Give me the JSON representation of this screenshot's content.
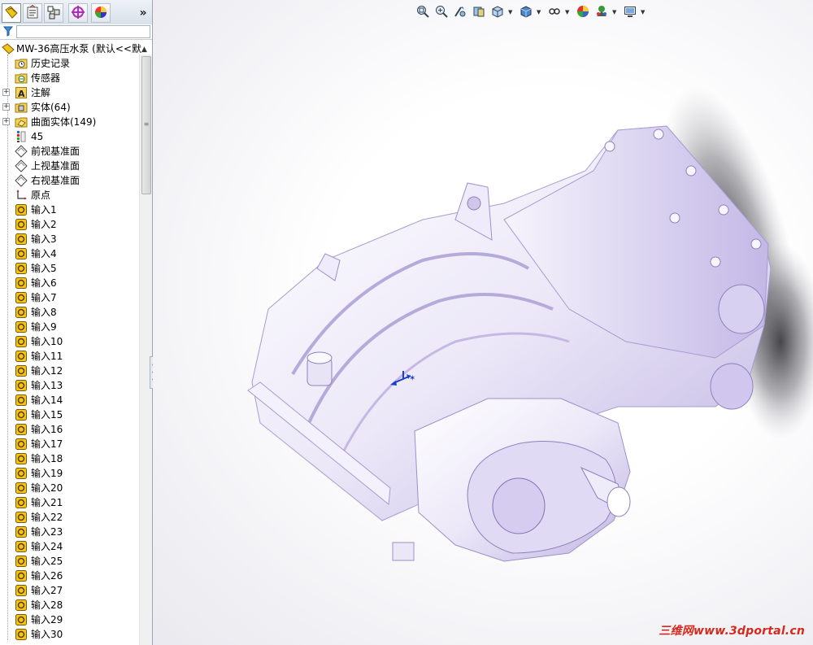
{
  "panel_tabs": [
    {
      "name": "feature-manager",
      "icon": "feature-tree-icon",
      "active": true
    },
    {
      "name": "property-manager",
      "icon": "property-manager-icon",
      "active": false
    },
    {
      "name": "configuration-manager",
      "icon": "configuration-manager-icon",
      "active": false
    },
    {
      "name": "dimxpert-manager",
      "icon": "dimxpert-icon",
      "active": false
    },
    {
      "name": "display-manager",
      "icon": "display-manager-icon",
      "active": false
    }
  ],
  "more_tabs": "»",
  "filter": {
    "icon": "filter-icon",
    "value": ""
  },
  "tree": {
    "root": {
      "label": "MW-36高压水泵 (默认<<默",
      "icon": "part-icon"
    },
    "items": [
      {
        "label": "历史记录",
        "icon": "history-folder-icon",
        "expandable": false
      },
      {
        "label": "传感器",
        "icon": "sensor-folder-icon",
        "expandable": false
      },
      {
        "label": "注解",
        "icon": "annotation-folder-icon",
        "expandable": true
      },
      {
        "label": "实体(64)",
        "icon": "solid-bodies-folder-icon",
        "expandable": true
      },
      {
        "label": "曲面实体(149)",
        "icon": "surface-bodies-folder-icon",
        "expandable": true
      },
      {
        "label": "45",
        "icon": "material-icon",
        "expandable": false
      },
      {
        "label": "前视基准面",
        "icon": "plane-icon",
        "expandable": false
      },
      {
        "label": "上视基准面",
        "icon": "plane-icon",
        "expandable": false
      },
      {
        "label": "右视基准面",
        "icon": "plane-icon",
        "expandable": false
      },
      {
        "label": "原点",
        "icon": "origin-icon",
        "expandable": false
      },
      {
        "label": "输入1",
        "icon": "imported-body-icon",
        "expandable": false
      },
      {
        "label": "输入2",
        "icon": "imported-body-icon",
        "expandable": false
      },
      {
        "label": "输入3",
        "icon": "imported-body-icon",
        "expandable": false
      },
      {
        "label": "输入4",
        "icon": "imported-body-icon",
        "expandable": false
      },
      {
        "label": "输入5",
        "icon": "imported-body-icon",
        "expandable": false
      },
      {
        "label": "输入6",
        "icon": "imported-body-icon",
        "expandable": false
      },
      {
        "label": "输入7",
        "icon": "imported-body-icon",
        "expandable": false
      },
      {
        "label": "输入8",
        "icon": "imported-body-icon",
        "expandable": false
      },
      {
        "label": "输入9",
        "icon": "imported-body-icon",
        "expandable": false
      },
      {
        "label": "输入10",
        "icon": "imported-body-icon",
        "expandable": false
      },
      {
        "label": "输入11",
        "icon": "imported-body-icon",
        "expandable": false
      },
      {
        "label": "输入12",
        "icon": "imported-body-icon",
        "expandable": false
      },
      {
        "label": "输入13",
        "icon": "imported-body-icon",
        "expandable": false
      },
      {
        "label": "输入14",
        "icon": "imported-body-icon",
        "expandable": false
      },
      {
        "label": "输入15",
        "icon": "imported-body-icon",
        "expandable": false
      },
      {
        "label": "输入16",
        "icon": "imported-body-icon",
        "expandable": false
      },
      {
        "label": "输入17",
        "icon": "imported-body-icon",
        "expandable": false
      },
      {
        "label": "输入18",
        "icon": "imported-body-icon",
        "expandable": false
      },
      {
        "label": "输入19",
        "icon": "imported-body-icon",
        "expandable": false
      },
      {
        "label": "输入20",
        "icon": "imported-body-icon",
        "expandable": false
      },
      {
        "label": "输入21",
        "icon": "imported-body-icon",
        "expandable": false
      },
      {
        "label": "输入22",
        "icon": "imported-body-icon",
        "expandable": false
      },
      {
        "label": "输入23",
        "icon": "imported-body-icon",
        "expandable": false
      },
      {
        "label": "输入24",
        "icon": "imported-body-icon",
        "expandable": false
      },
      {
        "label": "输入25",
        "icon": "imported-body-icon",
        "expandable": false
      },
      {
        "label": "输入26",
        "icon": "imported-body-icon",
        "expandable": false
      },
      {
        "label": "输入27",
        "icon": "imported-body-icon",
        "expandable": false
      },
      {
        "label": "输入28",
        "icon": "imported-body-icon",
        "expandable": false
      },
      {
        "label": "输入29",
        "icon": "imported-body-icon",
        "expandable": false
      },
      {
        "label": "输入30",
        "icon": "imported-body-icon",
        "expandable": false
      }
    ]
  },
  "heads_up_toolbar": [
    {
      "icon": "zoom-to-fit-icon",
      "dropdown": false
    },
    {
      "icon": "zoom-to-area-icon",
      "dropdown": false
    },
    {
      "icon": "previous-view-icon",
      "dropdown": false
    },
    {
      "icon": "section-view-icon",
      "dropdown": false
    },
    {
      "icon": "view-orientation-icon",
      "dropdown": true
    },
    {
      "icon": "display-style-icon",
      "dropdown": true
    },
    {
      "icon": "hide-show-items-icon",
      "dropdown": true
    },
    {
      "icon": "edit-appearance-icon",
      "dropdown": false
    },
    {
      "icon": "apply-scene-icon",
      "dropdown": true
    },
    {
      "icon": "view-settings-icon",
      "dropdown": true
    }
  ],
  "model_color": "#cfc6ea",
  "watermark": "三维网www.3dportal.cn"
}
